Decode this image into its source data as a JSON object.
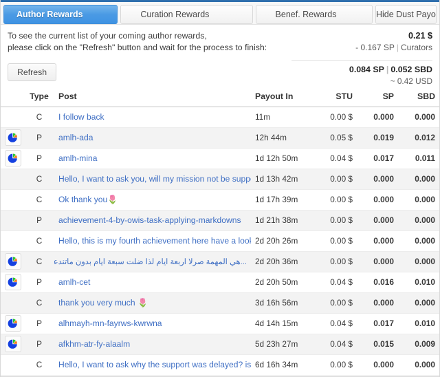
{
  "tabs": [
    {
      "label": "Author Rewards",
      "active": true
    },
    {
      "label": "Curation Rewards",
      "active": false
    },
    {
      "label": "Benef. Rewards",
      "active": false
    },
    {
      "label": "Hide Dust Payouts",
      "active": false
    }
  ],
  "info": {
    "line1": "To see the current list of your coming author rewards,",
    "line2": "please click on the \"Refresh\" button and wait for the process to finish:",
    "refresh_label": "Refresh"
  },
  "summary": {
    "total_usd": "0.21 $",
    "curators_amount": "- 0.167 SP",
    "curators_label": "Curators",
    "sp_amount": "0.084 SP",
    "sbd_amount": "0.052 SBD",
    "approx_usd": "~ 0.42 USD",
    "separator": "|"
  },
  "table": {
    "headers": {
      "icon": "",
      "type": "Type",
      "post": "Post",
      "payout_in": "Payout In",
      "stu": "STU",
      "sp": "SP",
      "sbd": "SBD"
    },
    "payout_header_color": "#22c931",
    "rows": [
      {
        "icon": false,
        "type": "C",
        "post": "I follow back",
        "rtl": false,
        "payout_in": "11m",
        "stu": "0.00 $",
        "sp": "0.000",
        "sbd": "0.000"
      },
      {
        "icon": true,
        "type": "P",
        "post": "amlh-ada",
        "rtl": false,
        "payout_in": "12h 44m",
        "stu": "0.05 $",
        "sp": "0.019",
        "sbd": "0.012"
      },
      {
        "icon": true,
        "type": "P",
        "post": "amlh-mina",
        "rtl": false,
        "payout_in": "1d 12h 50m",
        "stu": "0.04 $",
        "sp": "0.017",
        "sbd": "0.011"
      },
      {
        "icon": false,
        "type": "C",
        "post": "Hello, I want to ask you, will my mission not be supported?",
        "rtl": false,
        "payout_in": "1d 13h 42m",
        "stu": "0.00 $",
        "sp": "0.000",
        "sbd": "0.000"
      },
      {
        "icon": false,
        "type": "C",
        "post": "Ok thank you🌷",
        "rtl": false,
        "payout_in": "1d 17h 39m",
        "stu": "0.00 $",
        "sp": "0.000",
        "sbd": "0.000"
      },
      {
        "icon": false,
        "type": "P",
        "post": "achievement-4-by-owis-task-applying-markdowns",
        "rtl": false,
        "payout_in": "1d 21h 38m",
        "stu": "0.00 $",
        "sp": "0.000",
        "sbd": "0.000"
      },
      {
        "icon": false,
        "type": "C",
        "post": "Hello, this is my fourth achievement here have a look at it please thank you",
        "rtl": false,
        "payout_in": "2d 20h 26m",
        "stu": "0.00 $",
        "sp": "0.000",
        "sbd": "0.000"
      },
      {
        "icon": true,
        "type": "C",
        "post": "...هي المهمة صرلا اربعة ايام لذا ضلت سبعة ايام بدون ماتندعم ماحدا فيتو يدعمك عليه",
        "rtl": true,
        "payout_in": "2d 20h 36m",
        "stu": "0.00 $",
        "sp": "0.000",
        "sbd": "0.000"
      },
      {
        "icon": true,
        "type": "P",
        "post": "amlh-cet",
        "rtl": false,
        "payout_in": "2d 20h 50m",
        "stu": "0.04 $",
        "sp": "0.016",
        "sbd": "0.010"
      },
      {
        "icon": false,
        "type": "C",
        "post": "thank you very much 🌷",
        "rtl": false,
        "payout_in": "3d 16h 56m",
        "stu": "0.00 $",
        "sp": "0.000",
        "sbd": "0.000"
      },
      {
        "icon": true,
        "type": "P",
        "post": "alhmayh-mn-fayrws-kwrwna",
        "rtl": false,
        "payout_in": "4d 14h 15m",
        "stu": "0.04 $",
        "sp": "0.017",
        "sbd": "0.010"
      },
      {
        "icon": true,
        "type": "P",
        "post": "afkhm-atr-fy-alaalm",
        "rtl": false,
        "payout_in": "5d 23h 27m",
        "stu": "0.04 $",
        "sp": "0.015",
        "sbd": "0.009"
      },
      {
        "icon": false,
        "type": "C",
        "post": "Hello, I want to ask why the support was delayed? is this normal",
        "rtl": false,
        "payout_in": "6d 16h 34m",
        "stu": "0.00 $",
        "sp": "0.000",
        "sbd": "0.000"
      }
    ]
  },
  "icons": {
    "pie_chart": "pie-chart-icon"
  },
  "colors": {
    "active_tab": "#4a9ae4",
    "link": "#3f6fc4",
    "payout_green": "#22c931",
    "row_stripe": "#f3f3f3",
    "top_border": "#2f6fad"
  }
}
